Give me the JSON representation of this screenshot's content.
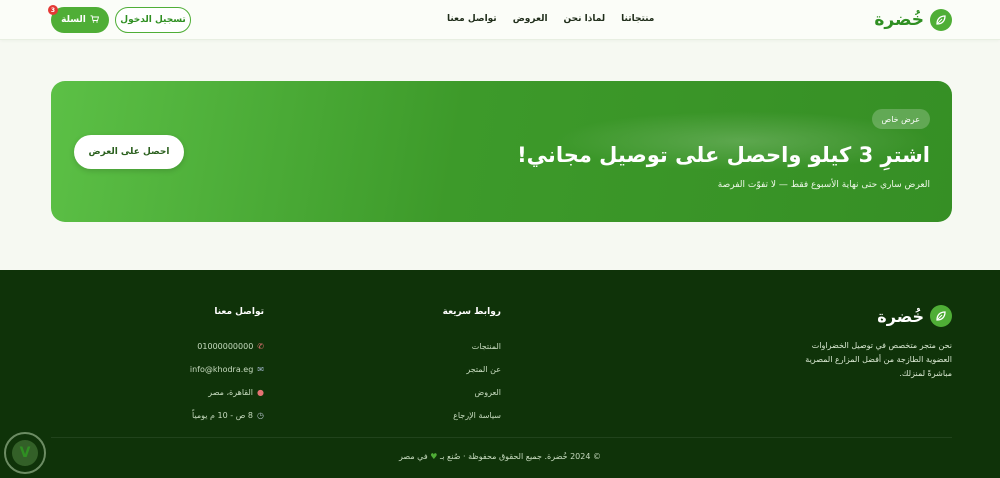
{
  "header": {
    "brand": "خُضرة",
    "nav": [
      "منتجاتنا",
      "لماذا نحن",
      "العروض",
      "تواصل معنا"
    ],
    "login_label": "تسجيل الدخول",
    "cart_label": "السلة",
    "cart_count": "3"
  },
  "promo": {
    "tag": "عرض خاص",
    "title": "اشترِ 3 كيلو واحصل على توصيل مجاني!",
    "subtitle": "العرض ساري حتى نهاية الأسبوع فقط — لا تفوّت الفرصة",
    "cta": "احصل على العرض"
  },
  "footer": {
    "brand": "خُضرة",
    "about": "نحن متجر متخصص في توصيل الخضراوات العضوية الطازجة من أفضل المزارع المصرية مباشرةً لمنزلك.",
    "links_title": "روابط سريعة",
    "links": [
      "المنتجات",
      "عن المتجر",
      "العروض",
      "سياسة الإرجاع"
    ],
    "contact_title": "تواصل معنا",
    "contact": {
      "phone": "01000000000",
      "email": "info@khodra.eg",
      "address": "القاهرة، مصر",
      "hours": "8 ص - 10 م يومياً"
    },
    "copyright": "© 2024 خُضرة. جميع الحقوق محفوظة · صُنع بـ",
    "copyright_end": "في مصر"
  },
  "colors": {
    "brand_green": "#4fae36",
    "footer_bg": "#0f3309",
    "badge_red": "#e53935"
  },
  "icons": {
    "brand": "leaf-icon",
    "cart": "cart-icon",
    "phone": "phone-icon",
    "email": "email-icon",
    "address": "pin-icon",
    "hours": "clock-icon",
    "heart": "heart-icon"
  }
}
